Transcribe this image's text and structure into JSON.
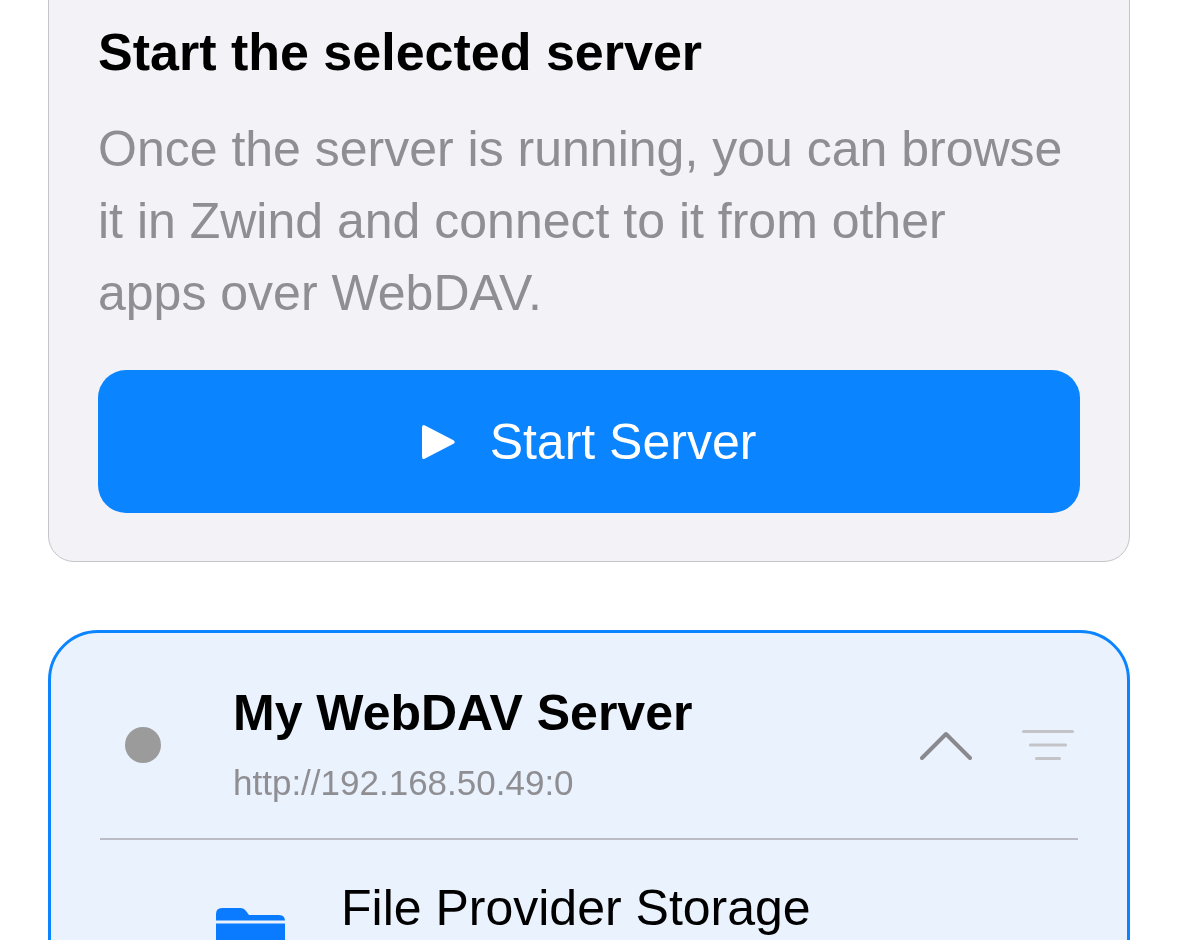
{
  "start_panel": {
    "title": "Start the selected server",
    "description": "Once the server is running, you can browse it in Zwind and connect to it from other apps over WebDAV.",
    "button": {
      "label": "Start Server"
    }
  },
  "servers": [
    {
      "name": "My WebDAV Server",
      "url": "http://192.168.50.49:0",
      "running": false,
      "selected": true,
      "expanded": true,
      "folders": [
        {
          "name": "File Provider Storage"
        }
      ]
    }
  ]
}
